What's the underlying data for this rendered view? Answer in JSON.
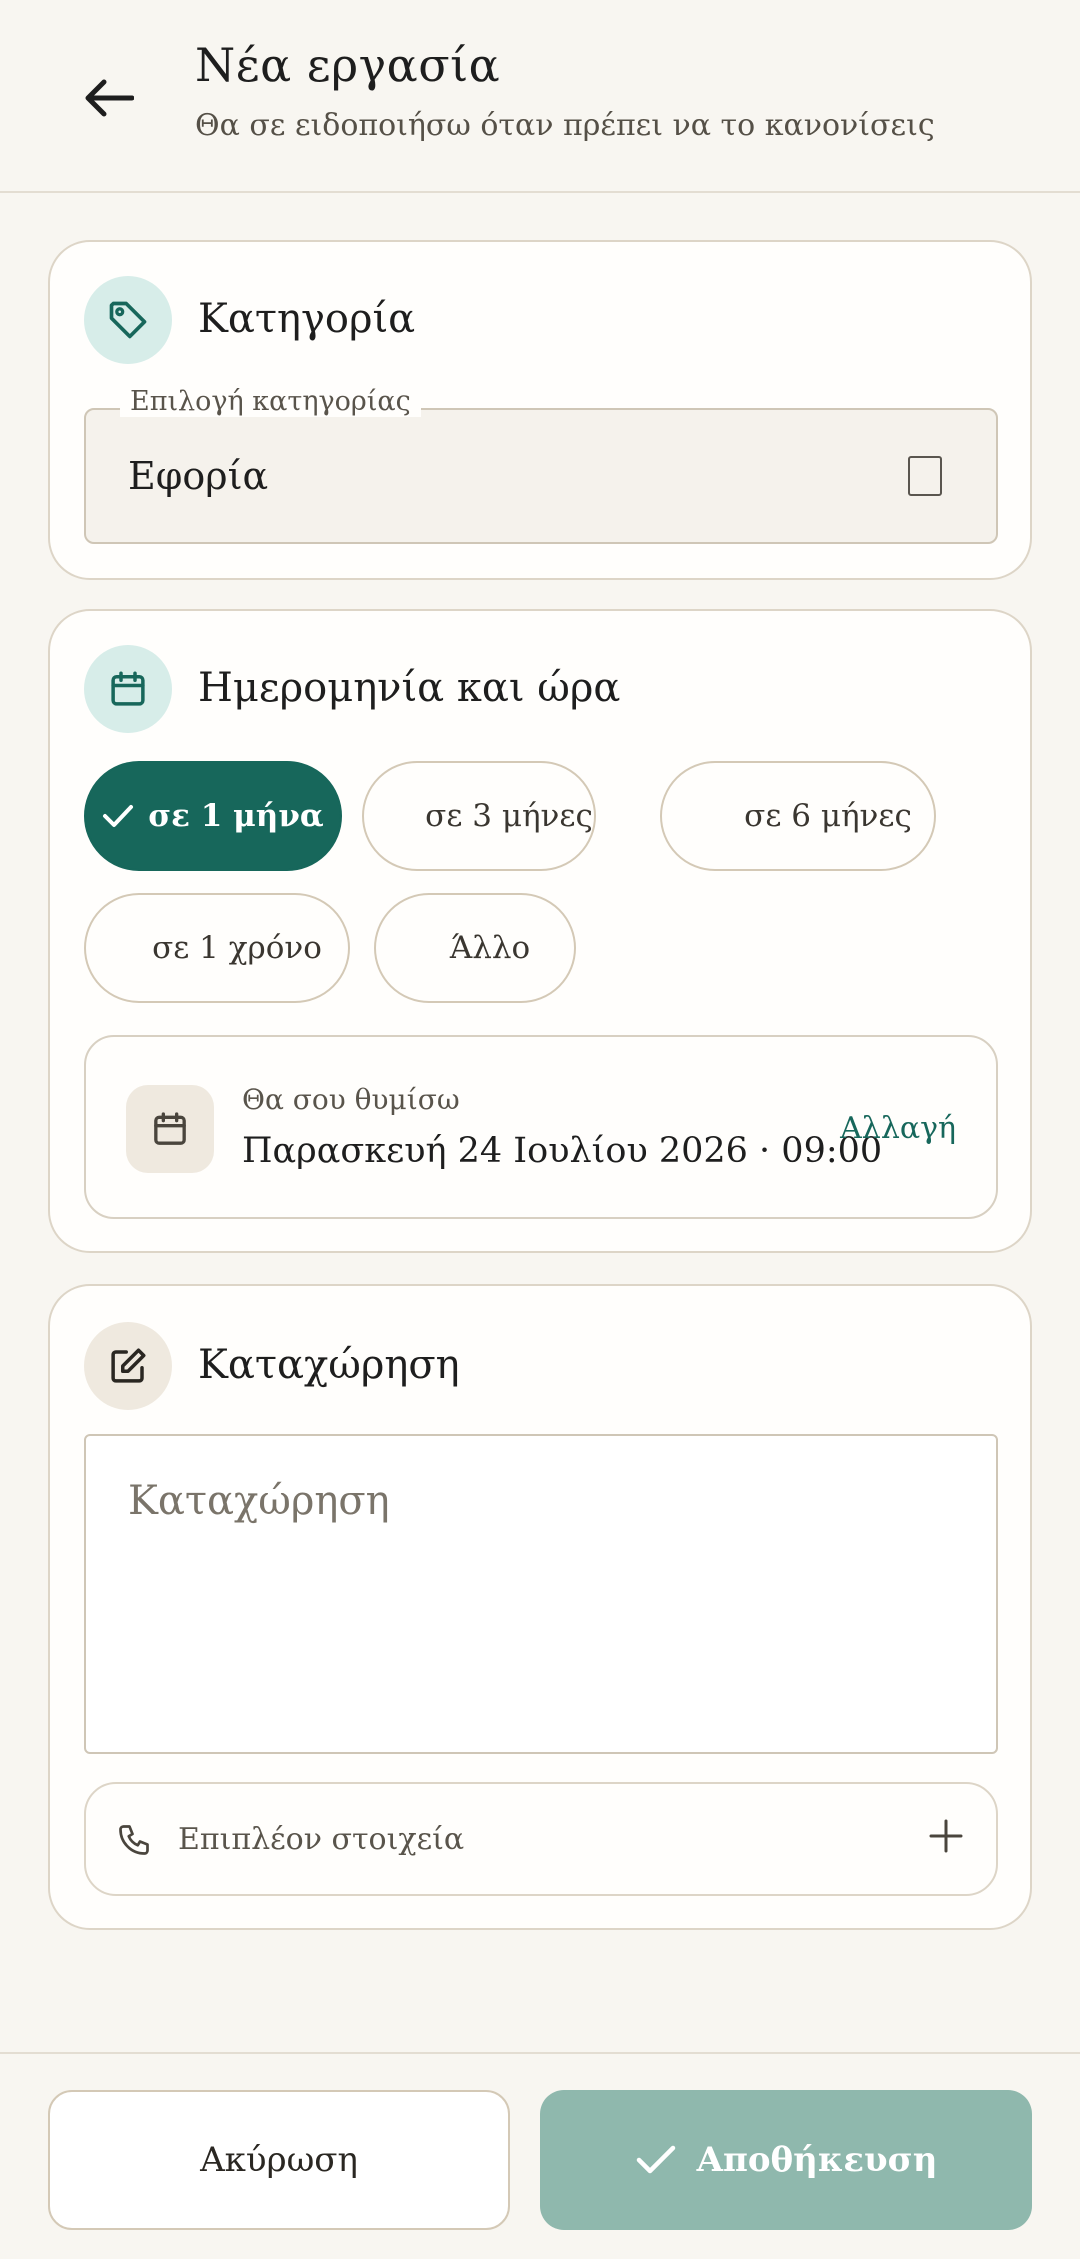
{
  "header": {
    "title": "Νέα εργασία",
    "subtitle": "Θα σε ειδοποιήσω όταν πρέπει να το κανονίσεις"
  },
  "category": {
    "section_title": "Κατηγορία",
    "field_legend": "Επιλογή κατηγορίας",
    "selected_value": "Εφορία"
  },
  "datetime": {
    "section_title": "Ημερομηνία και ώρα",
    "chips": [
      {
        "label": "σε 1 μήνα",
        "selected": true
      },
      {
        "label": "σε 3 μήνες",
        "selected": false
      },
      {
        "label": "σε 6 μήνες",
        "selected": false
      },
      {
        "label": "σε 1 χρόνο",
        "selected": false
      },
      {
        "label": "Άλλο",
        "selected": false
      }
    ],
    "reminder_label": "Θα σου θυμίσω",
    "reminder_date": "Παρασκευή 24 Ιουλίου 2026 · 09:00",
    "change_label": "Αλλαγή"
  },
  "entry": {
    "section_title": "Καταχώρηση",
    "placeholder": "Καταχώρηση",
    "extra_label": "Επιπλέον στοιχεία"
  },
  "actions": {
    "cancel_label": "Ακύρωση",
    "save_label": "Αποθήκευση"
  },
  "icons": {
    "back": "arrow-left-icon",
    "category": "tag-icon",
    "date": "calendar-icon",
    "entry": "edit-icon",
    "phone": "phone-icon",
    "plus": "plus-icon",
    "check": "check-icon"
  },
  "colors": {
    "accent": "#17675b",
    "accent_light": "#d7ede9",
    "save_disabled": "#8fb8ad",
    "background": "#f8f6f1"
  }
}
